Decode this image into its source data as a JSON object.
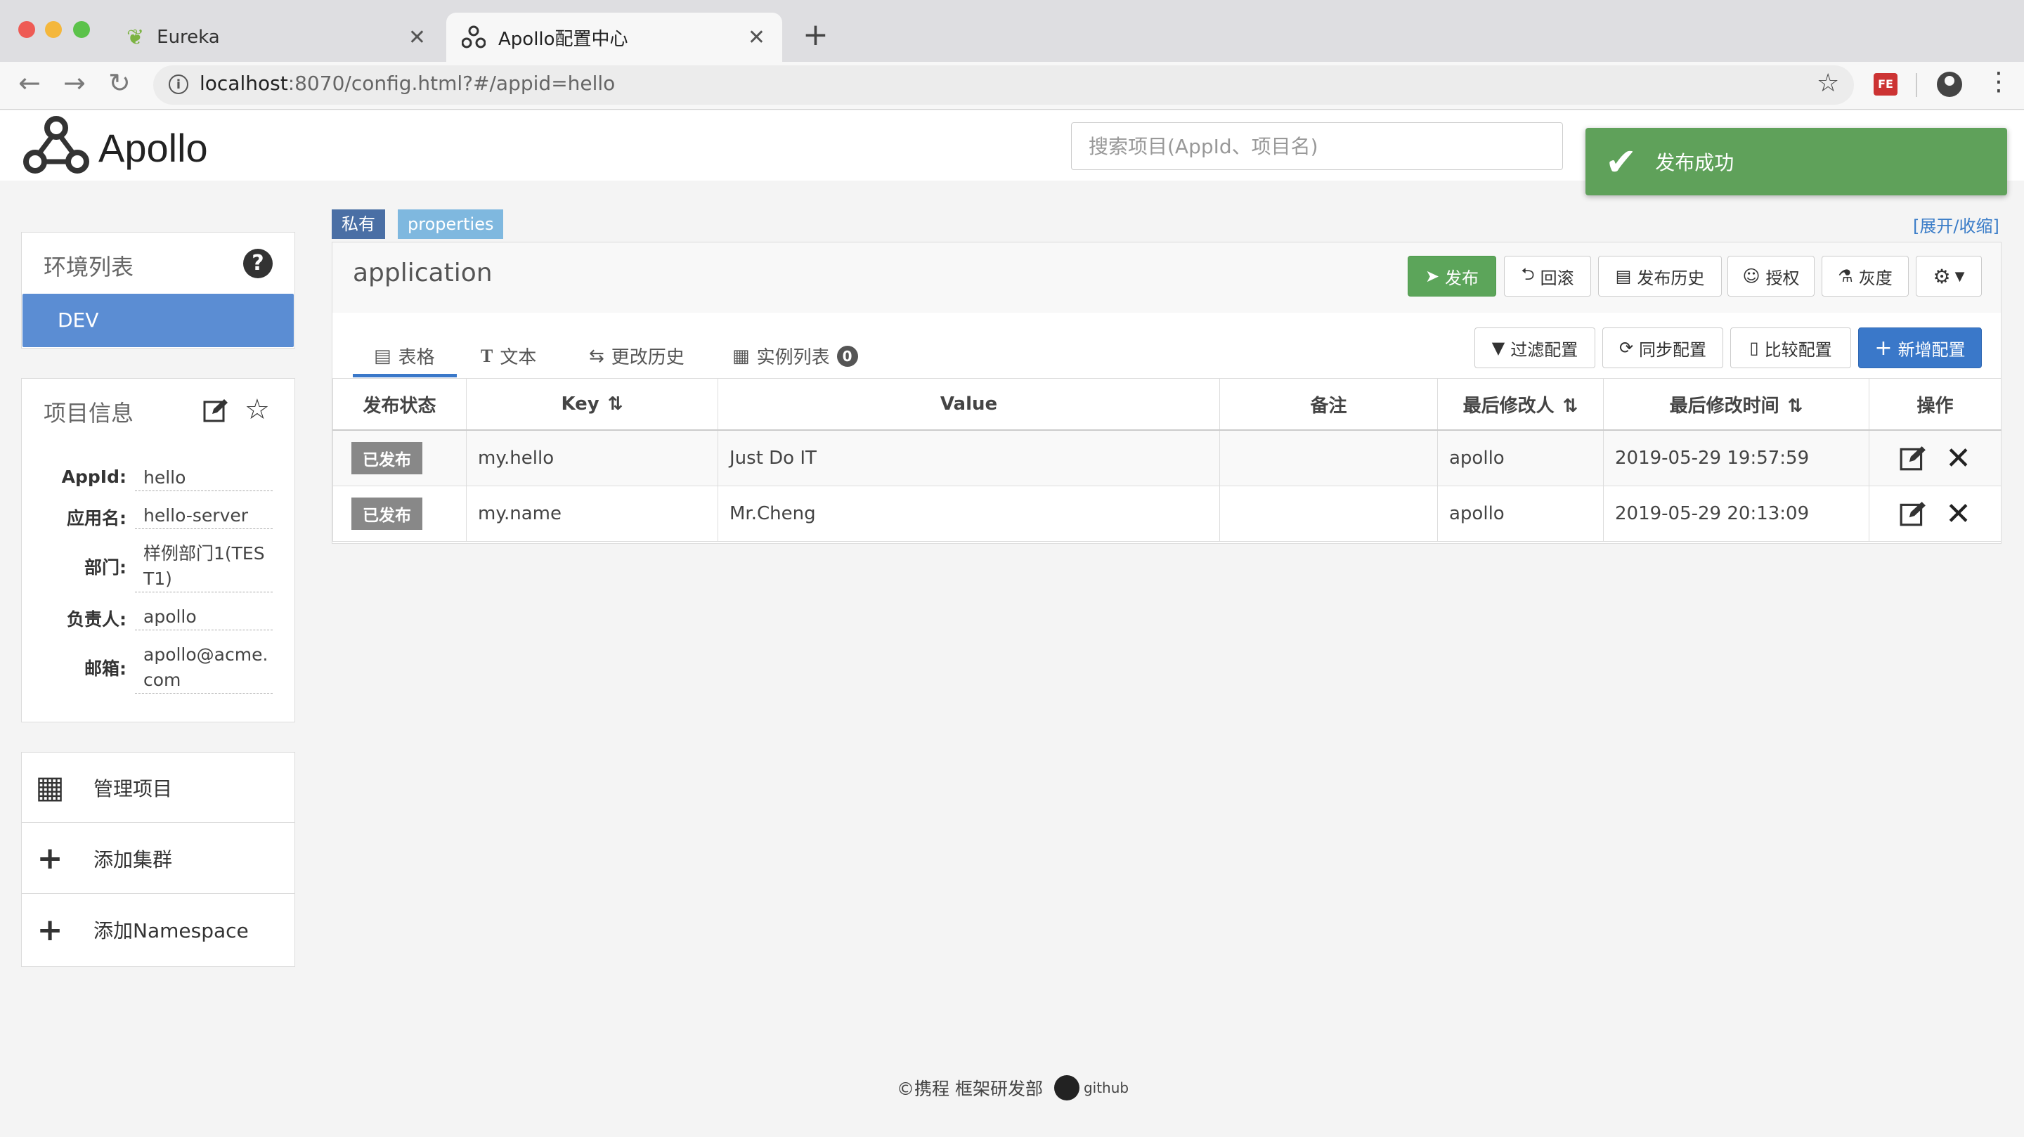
{
  "browser": {
    "tabs": [
      {
        "title": "Eureka",
        "active": false,
        "icon": "leaf-icon"
      },
      {
        "title": "Apollo配置中心",
        "active": true,
        "icon": "apollo-icon"
      }
    ],
    "url_host": "localhost",
    "url_path": ":8070/config.html?#/appid=hello",
    "extension_label": "FE"
  },
  "header": {
    "logo_text": "Apollo",
    "search_placeholder": "搜索项目(AppId、项目名)"
  },
  "toast": {
    "message": "发布成功"
  },
  "sidebar": {
    "env_title": "环境列表",
    "envs": [
      "DEV"
    ],
    "info_title": "项目信息",
    "info": [
      {
        "label": "AppId:",
        "value": "hello"
      },
      {
        "label": "应用名:",
        "value": "hello-server"
      },
      {
        "label": "部门:",
        "value": "样例部门1(TEST1)"
      },
      {
        "label": "负责人:",
        "value": "apollo"
      },
      {
        "label": "邮箱:",
        "value": "apollo@acme.com"
      }
    ],
    "actions": [
      {
        "label": "管理项目",
        "icon": "grid-icon"
      },
      {
        "label": "添加集群",
        "icon": "plus-icon"
      },
      {
        "label": "添加Namespace",
        "icon": "plus-icon"
      }
    ]
  },
  "namespace": {
    "badge_private": "私有",
    "badge_format": "properties",
    "expand_link": "[展开/收缩]",
    "name": "application",
    "buttons": [
      "发布",
      "回滚",
      "发布历史",
      "授权",
      "灰度"
    ],
    "subtabs": [
      "表格",
      "文本",
      "更改历史",
      "实例列表"
    ],
    "instance_count": "0",
    "tool_buttons": [
      "过滤配置",
      "同步配置",
      "比较配置",
      "新增配置"
    ]
  },
  "table": {
    "headers": [
      "发布状态",
      "Key",
      "Value",
      "备注",
      "最后修改人",
      "最后修改时间",
      "操作"
    ],
    "rows": [
      {
        "status": "已发布",
        "key": "my.hello",
        "value": "Just Do IT",
        "comment": "",
        "modifier": "apollo",
        "time": "2019-05-29 19:57:59"
      },
      {
        "status": "已发布",
        "key": "my.name",
        "value": "Mr.Cheng",
        "comment": "",
        "modifier": "apollo",
        "time": "2019-05-29 20:13:09"
      }
    ]
  },
  "footer": {
    "text": "©携程 框架研发部",
    "github": "github"
  },
  "colors": {
    "accent_blue": "#3a78c9",
    "success_green": "#5fa15a",
    "env_blue": "#5b8dd3"
  }
}
